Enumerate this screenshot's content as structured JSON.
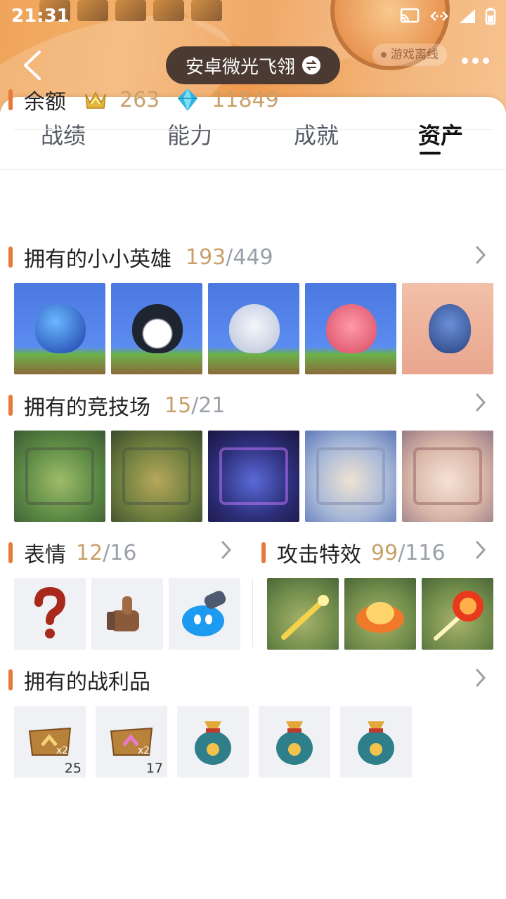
{
  "status_bar": {
    "time": "21:31"
  },
  "header": {
    "account_name": "安卓微光飞翎",
    "offline_label": "游戏离线"
  },
  "tabs": [
    {
      "label": "战绩"
    },
    {
      "label": "能力"
    },
    {
      "label": "成就"
    },
    {
      "label": "资产",
      "active": true
    }
  ],
  "balance": {
    "label": "余额",
    "gold_value": "263",
    "gem_value": "11849"
  },
  "heroes": {
    "title": "拥有的小小英雄",
    "owned": "193",
    "total": "/449"
  },
  "arenas": {
    "title": "拥有的竞技场",
    "owned": "15",
    "total": "/21"
  },
  "emotes": {
    "title": "表情",
    "owned": "12",
    "total": "/16"
  },
  "attack_effects": {
    "title": "攻击特效",
    "owned": "99",
    "total": "/116"
  },
  "loot": {
    "title": "拥有的战利品",
    "items": [
      {
        "icon": "gold-pass-icon",
        "qty": "25"
      },
      {
        "icon": "pink-pass-icon",
        "qty": "17"
      },
      {
        "icon": "loot-bag-icon",
        "qty": ""
      },
      {
        "icon": "loot-bag-icon",
        "qty": ""
      },
      {
        "icon": "loot-bag-icon",
        "qty": ""
      }
    ]
  },
  "colors": {
    "accent_bar": "#e8793a",
    "count_gold": "#c9a06a",
    "count_total_gray": "#9aa0a8"
  }
}
